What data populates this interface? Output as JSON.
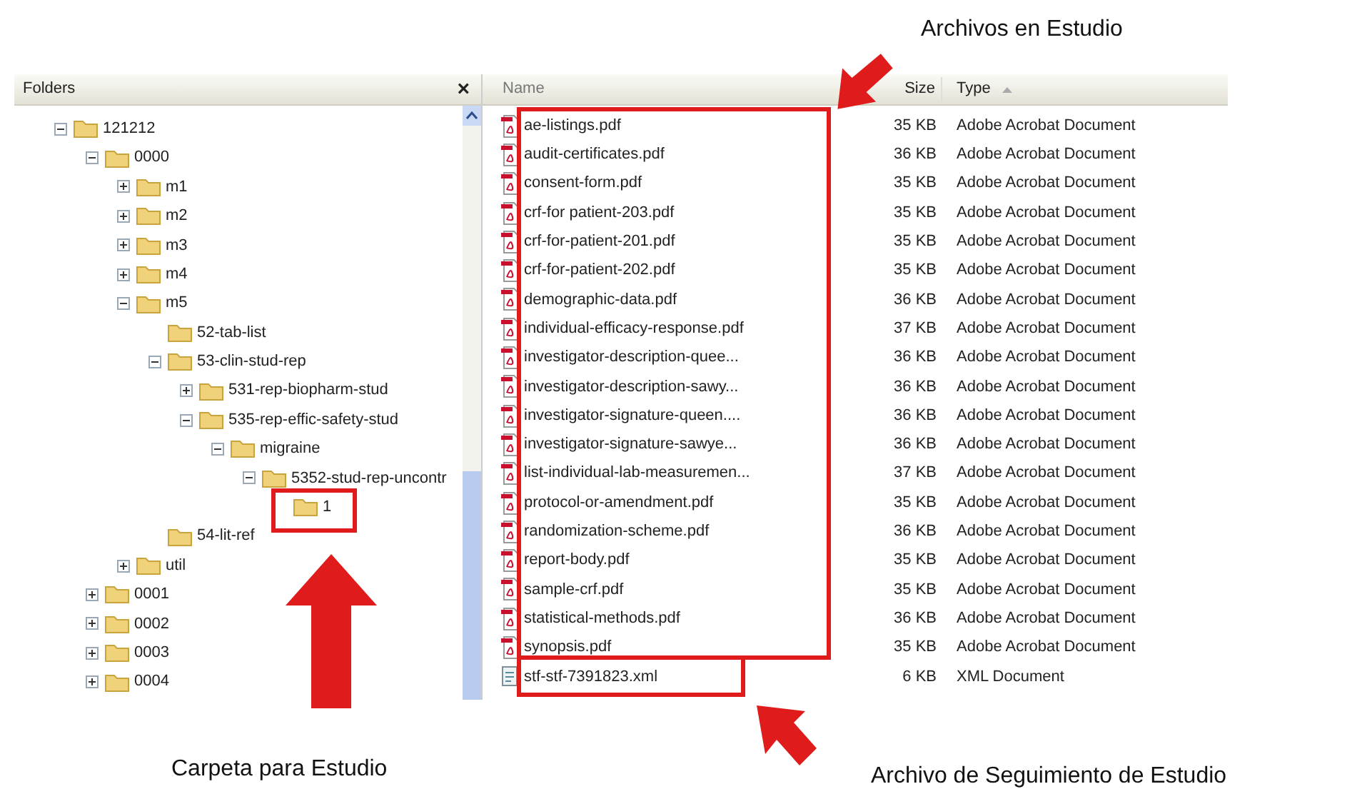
{
  "folders_pane": {
    "title": "Folders",
    "close": "×",
    "tree": [
      {
        "label": "121212",
        "expanded": true,
        "children": [
          {
            "label": "0000",
            "expanded": true,
            "children": [
              {
                "label": "m1",
                "expanded": false
              },
              {
                "label": "m2",
                "expanded": false
              },
              {
                "label": "m3",
                "expanded": false
              },
              {
                "label": "m4",
                "expanded": false
              },
              {
                "label": "m5",
                "expanded": true,
                "children": [
                  {
                    "label": "52-tab-list"
                  },
                  {
                    "label": "53-clin-stud-rep",
                    "expanded": true,
                    "children": [
                      {
                        "label": "531-rep-biopharm-stud",
                        "expanded": false
                      },
                      {
                        "label": "535-rep-effic-safety-stud",
                        "expanded": true,
                        "children": [
                          {
                            "label": "migraine",
                            "expanded": true,
                            "children": [
                              {
                                "label": "5352-stud-rep-uncontr",
                                "expanded": true,
                                "children": [
                                  {
                                    "label": "1"
                                  }
                                ]
                              }
                            ]
                          }
                        ]
                      }
                    ]
                  },
                  {
                    "label": "54-lit-ref"
                  }
                ]
              },
              {
                "label": "util",
                "expanded": false
              }
            ]
          },
          {
            "label": "0001",
            "expanded": false
          },
          {
            "label": "0002",
            "expanded": false
          },
          {
            "label": "0003",
            "expanded": false
          },
          {
            "label": "0004",
            "expanded": false
          }
        ]
      }
    ]
  },
  "file_list": {
    "columns": [
      {
        "label": "Name"
      },
      {
        "label": "Size"
      },
      {
        "label": "Type",
        "sorted": true
      }
    ],
    "rows": [
      {
        "kind": "pdf",
        "name": "ae-listings.pdf",
        "size": "35 KB",
        "type": "Adobe Acrobat Document"
      },
      {
        "kind": "pdf",
        "name": "audit-certificates.pdf",
        "size": "36 KB",
        "type": "Adobe Acrobat Document"
      },
      {
        "kind": "pdf",
        "name": "consent-form.pdf",
        "size": "35 KB",
        "type": "Adobe Acrobat Document"
      },
      {
        "kind": "pdf",
        "name": "crf-for patient-203.pdf",
        "size": "35 KB",
        "type": "Adobe Acrobat Document"
      },
      {
        "kind": "pdf",
        "name": "crf-for-patient-201.pdf",
        "size": "35 KB",
        "type": "Adobe Acrobat Document"
      },
      {
        "kind": "pdf",
        "name": "crf-for-patient-202.pdf",
        "size": "35 KB",
        "type": "Adobe Acrobat Document"
      },
      {
        "kind": "pdf",
        "name": "demographic-data.pdf",
        "size": "36 KB",
        "type": "Adobe Acrobat Document"
      },
      {
        "kind": "pdf",
        "name": "individual-efficacy-response.pdf",
        "size": "37 KB",
        "type": "Adobe Acrobat Document"
      },
      {
        "kind": "pdf",
        "name": "investigator-description-quee...",
        "size": "36 KB",
        "type": "Adobe Acrobat Document"
      },
      {
        "kind": "pdf",
        "name": "investigator-description-sawy...",
        "size": "36 KB",
        "type": "Adobe Acrobat Document"
      },
      {
        "kind": "pdf",
        "name": "investigator-signature-queen....",
        "size": "36 KB",
        "type": "Adobe Acrobat Document"
      },
      {
        "kind": "pdf",
        "name": "investigator-signature-sawye...",
        "size": "36 KB",
        "type": "Adobe Acrobat Document"
      },
      {
        "kind": "pdf",
        "name": "list-individual-lab-measuremen...",
        "size": "37 KB",
        "type": "Adobe Acrobat Document"
      },
      {
        "kind": "pdf",
        "name": "protocol-or-amendment.pdf",
        "size": "35 KB",
        "type": "Adobe Acrobat Document"
      },
      {
        "kind": "pdf",
        "name": "randomization-scheme.pdf",
        "size": "36 KB",
        "type": "Adobe Acrobat Document"
      },
      {
        "kind": "pdf",
        "name": "report-body.pdf",
        "size": "35 KB",
        "type": "Adobe Acrobat Document"
      },
      {
        "kind": "pdf",
        "name": "sample-crf.pdf",
        "size": "35 KB",
        "type": "Adobe Acrobat Document"
      },
      {
        "kind": "pdf",
        "name": "statistical-methods.pdf",
        "size": "36 KB",
        "type": "Adobe Acrobat Document"
      },
      {
        "kind": "pdf",
        "name": "synopsis.pdf",
        "size": "35 KB",
        "type": "Adobe Acrobat Document"
      },
      {
        "kind": "xml",
        "name": "stf-stf-7391823.xml",
        "size": "6 KB",
        "type": "XML Document"
      }
    ]
  },
  "annotations": {
    "files_label": "Archivos en Estudio",
    "folder_label": "Carpeta para Estudio",
    "tracking_label": "Archivo de Seguimiento de Estudio"
  }
}
